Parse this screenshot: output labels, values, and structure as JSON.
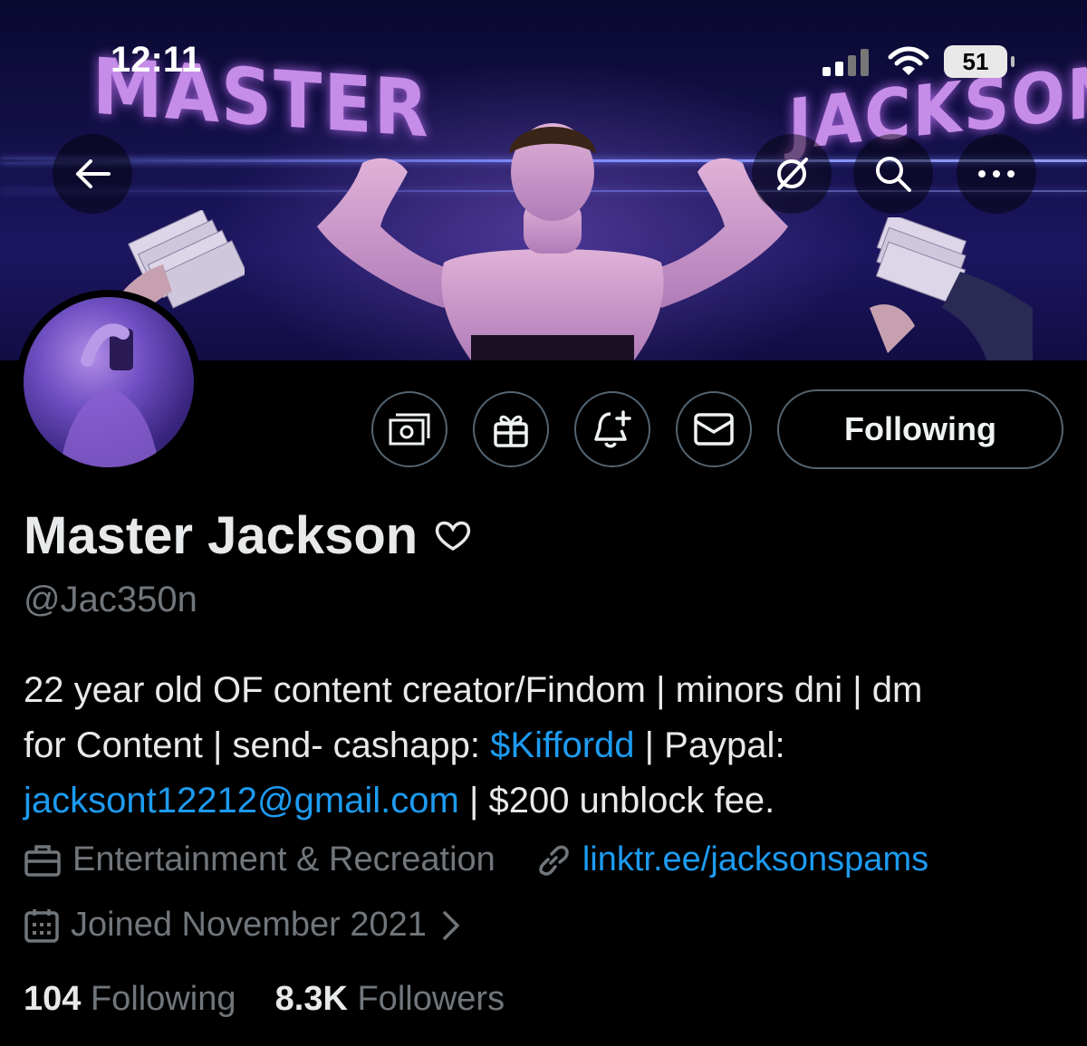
{
  "status_bar": {
    "time": "12:11",
    "battery": "51"
  },
  "banner": {
    "word_left": "MASTER",
    "word_right": "JACKSON"
  },
  "profile": {
    "name": "Master Jackson",
    "handle": "@Jac350n",
    "follow_button_label": "Following",
    "bio": {
      "line1": "22 year old OF content creator/Findom | minors dni | dm",
      "line2_prefix": "for Content | send- cashapp: ",
      "cashtag": "$Kiffordd",
      "line2_suffix": " | Paypal:",
      "email": "jacksont12212@gmail.com",
      "line3_suffix": " | $200 unblock fee."
    },
    "category": "Entertainment & Recreation",
    "website": "linktr.ee/jacksonspams",
    "joined": "Joined November 2021",
    "following_count": "104",
    "following_label": "Following",
    "followers_count": "8.3K",
    "followers_label": "Followers"
  },
  "colors": {
    "background": "#000000",
    "text": "#e7e9ea",
    "muted": "#71767b",
    "link": "#1d9bf0",
    "border": "#536471"
  },
  "icons": [
    "back-arrow-icon",
    "bird-off-icon",
    "search-icon",
    "more-icon",
    "money-icon",
    "gift-icon",
    "bell-plus-icon",
    "mail-icon",
    "briefcase-icon",
    "link-icon",
    "calendar-icon",
    "chevron-right-icon",
    "heart-badge-icon"
  ]
}
